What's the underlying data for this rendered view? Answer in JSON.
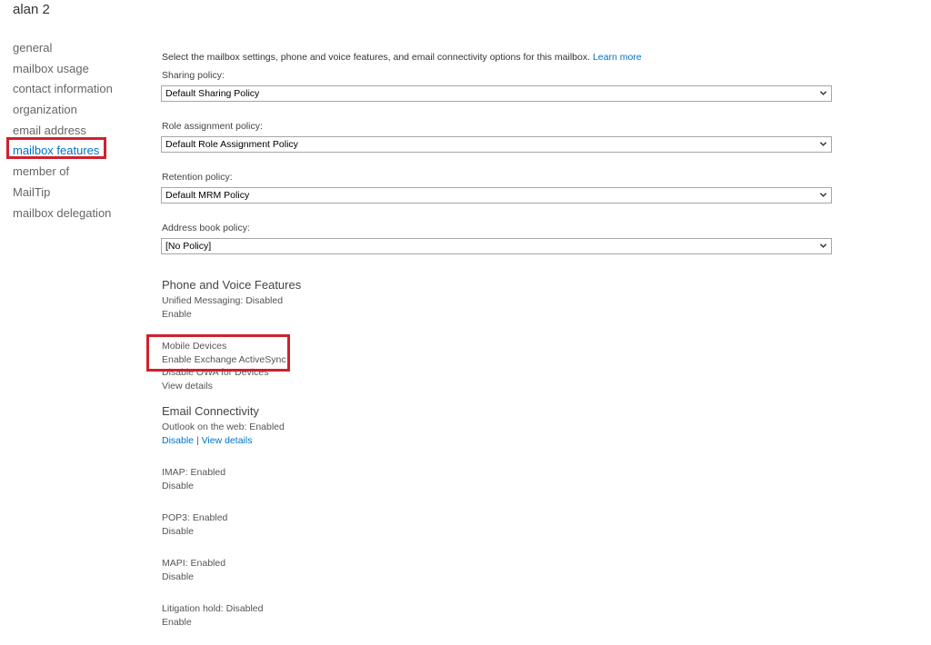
{
  "title": "alan 2",
  "nav": {
    "items": [
      {
        "label": "general"
      },
      {
        "label": "mailbox usage"
      },
      {
        "label": "contact information"
      },
      {
        "label": "organization"
      },
      {
        "label": "email address"
      },
      {
        "label": "mailbox features"
      },
      {
        "label": "member of"
      },
      {
        "label": "MailTip"
      },
      {
        "label": "mailbox delegation"
      }
    ],
    "selected": "mailbox features"
  },
  "intro": {
    "text": "Select the mailbox settings, phone and voice features, and email connectivity options for this mailbox.",
    "link": "Learn more"
  },
  "policies": {
    "sharing": {
      "label": "Sharing policy:",
      "value": "Default Sharing Policy"
    },
    "role_assignment": {
      "label": "Role assignment policy:",
      "value": "Default Role Assignment Policy"
    },
    "retention": {
      "label": "Retention policy:",
      "value": "Default MRM Policy"
    },
    "address_book": {
      "label": "Address book policy:",
      "value": "[No Policy]"
    }
  },
  "phone_voice": {
    "title": "Phone and Voice Features",
    "unified_messaging": "Unified Messaging: Disabled",
    "action": "Enable"
  },
  "mobile": {
    "title": "Mobile Devices",
    "activesync_action": "Enable Exchange ActiveSync",
    "owa_action": "Disable OWA for Devices",
    "details": "View details"
  },
  "email_connectivity": {
    "title": "Email Connectivity",
    "owa_status": "Outlook on the web: Enabled",
    "owa_disable": "Disable",
    "separator": "|",
    "owa_details": "View details",
    "imap_status": "IMAP: Enabled",
    "imap_action": "Disable",
    "pop3_status": "POP3: Enabled",
    "pop3_action": "Disable",
    "mapi_status": "MAPI: Enabled",
    "mapi_action": "Disable"
  },
  "litigation": {
    "status": "Litigation hold: Disabled",
    "action": "Enable"
  },
  "colors": {
    "link": "#0072c6",
    "highlight": "#d0202e",
    "text": "#333333"
  },
  "icons": {
    "dropdown": "chevron-down-icon"
  }
}
